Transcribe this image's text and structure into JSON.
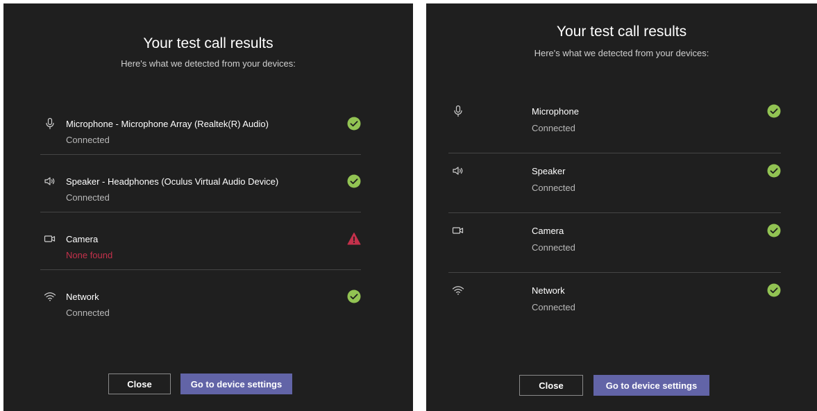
{
  "colors": {
    "panel_bg": "#1f1f1f",
    "success": "#92c353",
    "error": "#c4314b",
    "primary_button": "#6264a7"
  },
  "left_panel": {
    "title": "Your test call results",
    "subtitle": "Here's what we detected from your devices:",
    "devices": [
      {
        "icon": "microphone-icon",
        "name": "Microphone - Microphone Array (Realtek(R) Audio)",
        "status": "Connected",
        "result": "success"
      },
      {
        "icon": "speaker-icon",
        "name": "Speaker - Headphones (Oculus Virtual Audio Device)",
        "status": "Connected",
        "result": "success"
      },
      {
        "icon": "camera-icon",
        "name": "Camera",
        "status": "None found",
        "result": "error"
      },
      {
        "icon": "wifi-icon",
        "name": "Network",
        "status": "Connected",
        "result": "success"
      }
    ],
    "close_label": "Close",
    "settings_label": "Go to device settings"
  },
  "right_panel": {
    "title": "Your test call results",
    "subtitle": "Here's what we detected from your devices:",
    "devices": [
      {
        "icon": "microphone-icon",
        "name": "Microphone",
        "status": "Connected",
        "result": "success"
      },
      {
        "icon": "speaker-icon",
        "name": "Speaker",
        "status": "Connected",
        "result": "success"
      },
      {
        "icon": "camera-icon",
        "name": "Camera",
        "status": "Connected",
        "result": "success"
      },
      {
        "icon": "wifi-icon",
        "name": "Network",
        "status": "Connected",
        "result": "success"
      }
    ],
    "close_label": "Close",
    "settings_label": "Go to device settings"
  }
}
